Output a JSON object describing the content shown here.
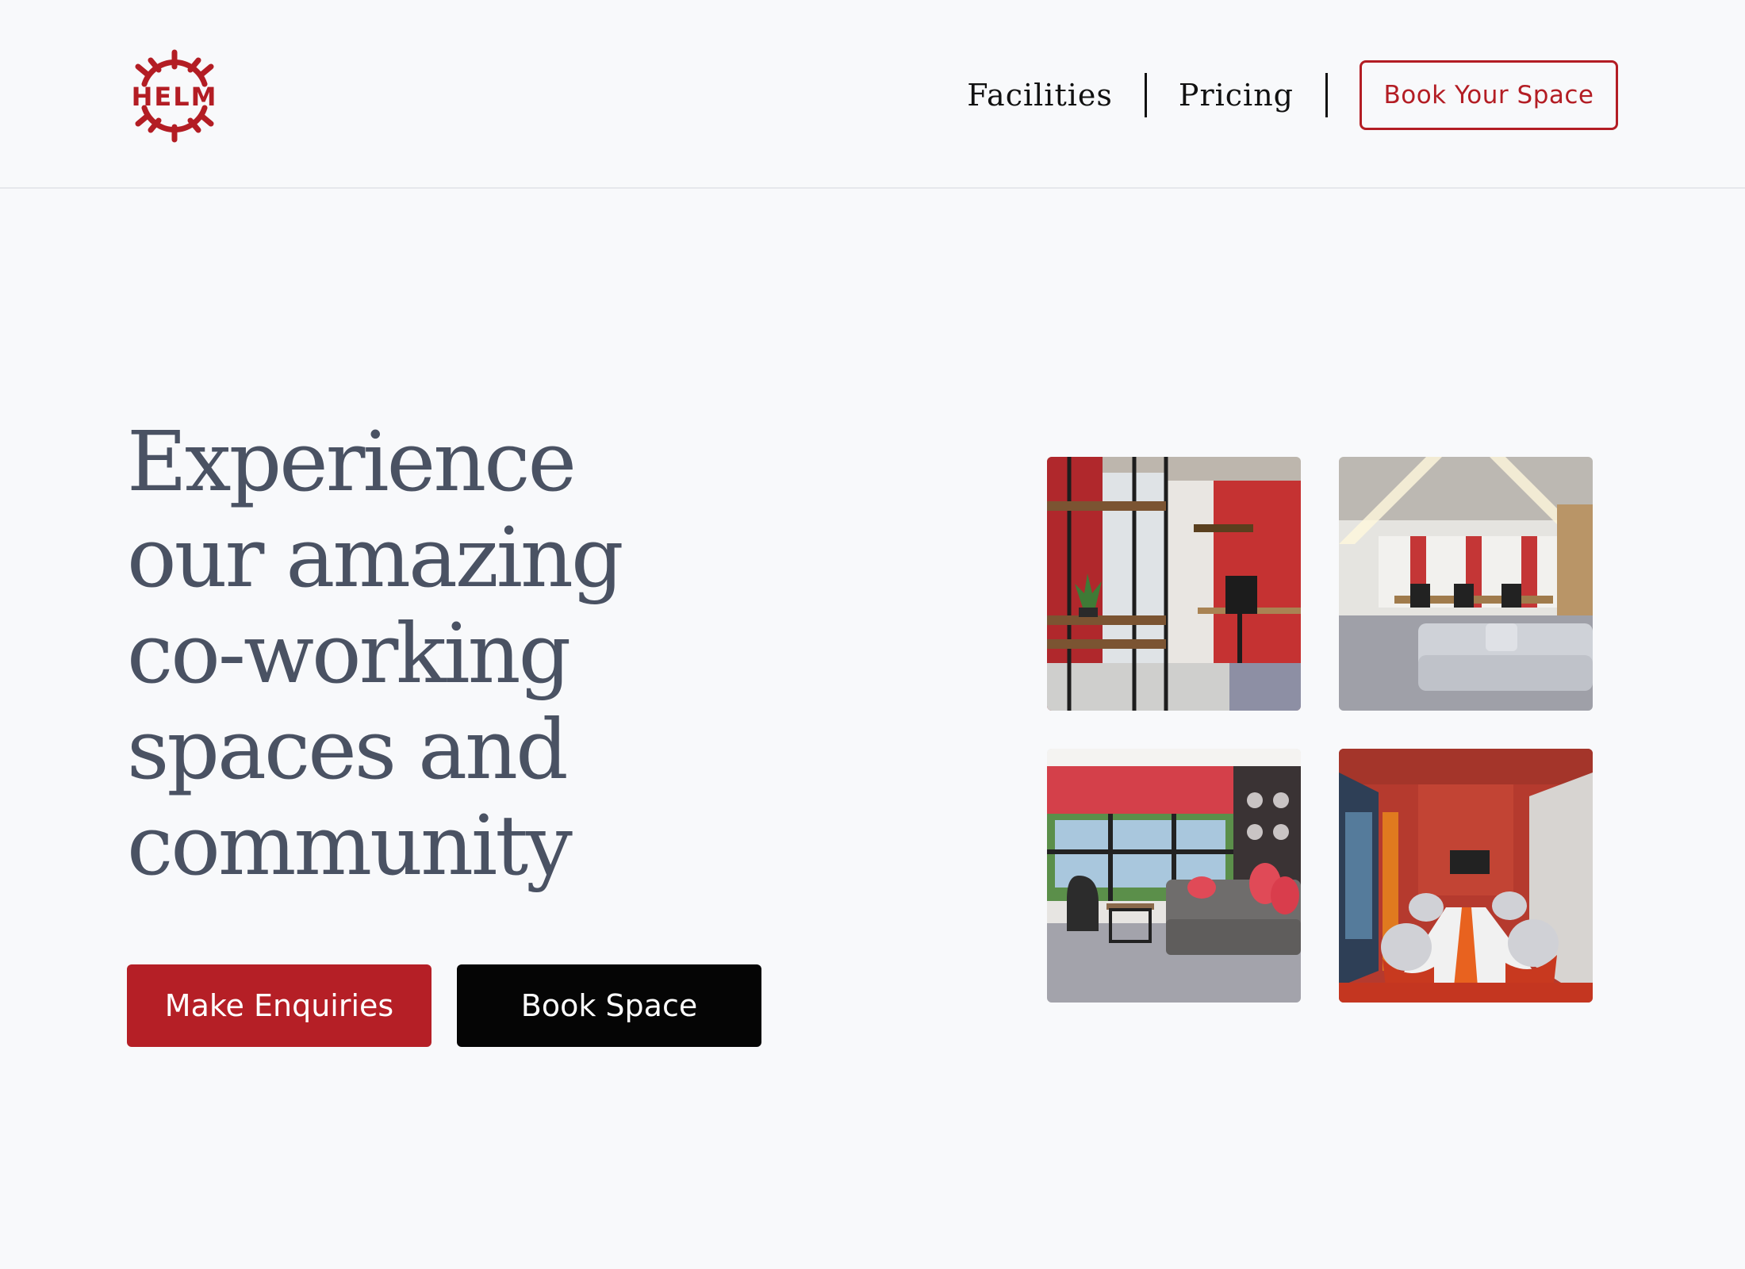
{
  "brand": {
    "logo_text": "HELM",
    "color": "#b31d24"
  },
  "nav": {
    "items": [
      {
        "label": "Facilities"
      },
      {
        "label": "Pricing"
      }
    ],
    "cta_label": "Book Your Space"
  },
  "hero": {
    "title_lines": [
      "Experience",
      "our amazing",
      "co-working",
      "spaces and",
      "community"
    ],
    "primary_button": "Make Enquiries",
    "secondary_button": "Book Space"
  },
  "gallery": {
    "images": [
      {
        "icon": "office-desk-image"
      },
      {
        "icon": "open-workspace-image"
      },
      {
        "icon": "lounge-image"
      },
      {
        "icon": "meeting-room-image"
      }
    ]
  },
  "colors": {
    "accent": "#b51f26",
    "dark_button": "#050505",
    "heading": "#4a5263",
    "background": "#f8f9fb"
  }
}
